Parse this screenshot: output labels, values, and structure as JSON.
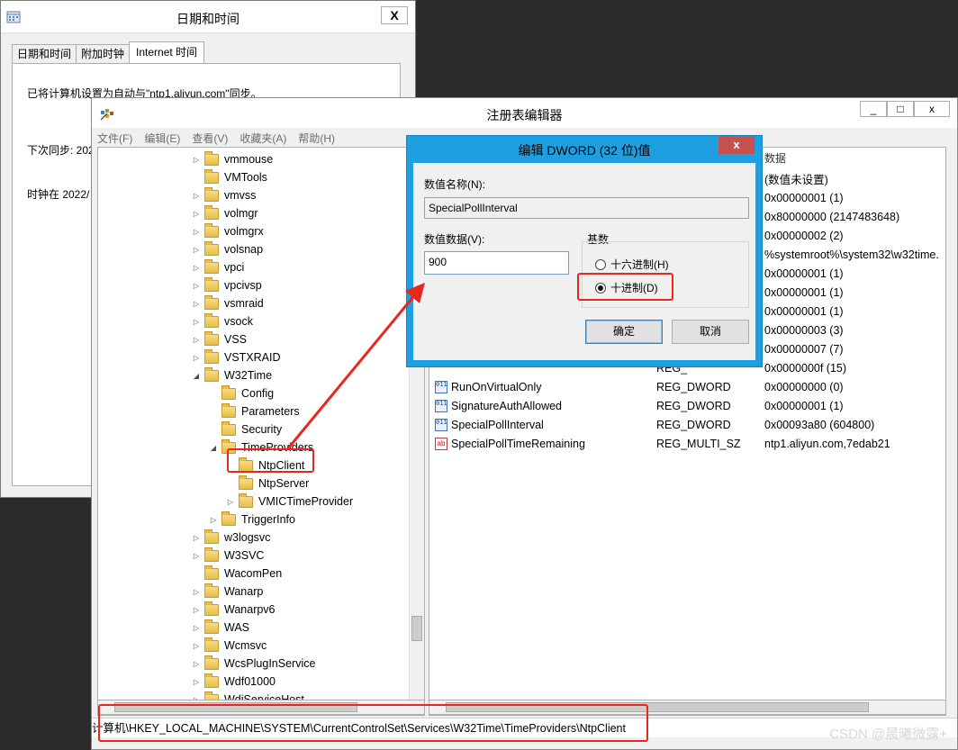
{
  "datetime_window": {
    "title": "日期和时间",
    "close_label": "X",
    "tabs": [
      "日期和时间",
      "附加时钟",
      "Internet 时间"
    ],
    "sync_text": "已将计算机设置为自动与\"ntp1.aliyun.com\"同步。",
    "next_sync": "下次同步: 202",
    "clock_text": "时钟在 2022/"
  },
  "regedit": {
    "title": "注册表编辑器",
    "window_buttons": [
      "_",
      "□",
      "x"
    ],
    "menu": [
      "文件(F)",
      "编辑(E)",
      "查看(V)",
      "收藏夹(A)",
      "帮助(H)"
    ],
    "tree": [
      {
        "label": "vmmouse",
        "depth": 0,
        "expand": "right"
      },
      {
        "label": "VMTools",
        "depth": 0,
        "expand": "none"
      },
      {
        "label": "vmvss",
        "depth": 0,
        "expand": "right"
      },
      {
        "label": "volmgr",
        "depth": 0,
        "expand": "right"
      },
      {
        "label": "volmgrx",
        "depth": 0,
        "expand": "right"
      },
      {
        "label": "volsnap",
        "depth": 0,
        "expand": "right"
      },
      {
        "label": "vpci",
        "depth": 0,
        "expand": "right"
      },
      {
        "label": "vpcivsp",
        "depth": 0,
        "expand": "right"
      },
      {
        "label": "vsmraid",
        "depth": 0,
        "expand": "right"
      },
      {
        "label": "vsock",
        "depth": 0,
        "expand": "right"
      },
      {
        "label": "VSS",
        "depth": 0,
        "expand": "right"
      },
      {
        "label": "VSTXRAID",
        "depth": 0,
        "expand": "right"
      },
      {
        "label": "W32Time",
        "depth": 0,
        "expand": "down"
      },
      {
        "label": "Config",
        "depth": 1,
        "expand": "none"
      },
      {
        "label": "Parameters",
        "depth": 1,
        "expand": "none"
      },
      {
        "label": "Security",
        "depth": 1,
        "expand": "none"
      },
      {
        "label": "TimeProviders",
        "depth": 1,
        "expand": "down"
      },
      {
        "label": "NtpClient",
        "depth": 2,
        "expand": "none"
      },
      {
        "label": "NtpServer",
        "depth": 2,
        "expand": "none"
      },
      {
        "label": "VMICTimeProvider",
        "depth": 2,
        "expand": "right"
      },
      {
        "label": "TriggerInfo",
        "depth": 1,
        "expand": "right"
      },
      {
        "label": "w3logsvc",
        "depth": 0,
        "expand": "right"
      },
      {
        "label": "W3SVC",
        "depth": 0,
        "expand": "right"
      },
      {
        "label": "WacomPen",
        "depth": 0,
        "expand": "none"
      },
      {
        "label": "Wanarp",
        "depth": 0,
        "expand": "right"
      },
      {
        "label": "Wanarpv6",
        "depth": 0,
        "expand": "right"
      },
      {
        "label": "WAS",
        "depth": 0,
        "expand": "right"
      },
      {
        "label": "Wcmsvc",
        "depth": 0,
        "expand": "right"
      },
      {
        "label": "WcsPlugInService",
        "depth": 0,
        "expand": "right"
      },
      {
        "label": "Wdf01000",
        "depth": 0,
        "expand": "right"
      },
      {
        "label": "WdiServiceHost",
        "depth": 0,
        "expand": "right"
      }
    ],
    "list_header_data": "数据",
    "values": [
      {
        "name": "",
        "type": "",
        "data": "(数值未设置)",
        "icon": "none"
      },
      {
        "name": "",
        "type": "",
        "data": "0x00000001 (1)",
        "icon": "none"
      },
      {
        "name": "",
        "type": "",
        "data": "0x80000000 (2147483648)",
        "icon": "none"
      },
      {
        "name": "",
        "type": "",
        "data": "0x00000002 (2)",
        "icon": "none"
      },
      {
        "name": "",
        "type": "",
        "data": "%systemroot%\\system32\\w32time.",
        "icon": "none"
      },
      {
        "name": "",
        "type": "",
        "data": "0x00000001 (1)",
        "icon": "none"
      },
      {
        "name": "",
        "type": "",
        "data": "0x00000001 (1)",
        "icon": "none"
      },
      {
        "name": "",
        "type": "",
        "data": "0x00000001 (1)",
        "icon": "none"
      },
      {
        "name": "",
        "type": "",
        "data": "0x00000003 (3)",
        "icon": "none"
      },
      {
        "name": "",
        "type": "",
        "data": "0x00000007 (7)",
        "icon": "none"
      },
      {
        "name": "",
        "type": "REG_",
        "data": "0x0000000f (15)",
        "icon": "none"
      },
      {
        "name": "RunOnVirtualOnly",
        "type": "REG_DWORD",
        "data": "0x00000000 (0)",
        "icon": "bin"
      },
      {
        "name": "SignatureAuthAllowed",
        "type": "REG_DWORD",
        "data": "0x00000001 (1)",
        "icon": "bin"
      },
      {
        "name": "SpecialPollInterval",
        "type": "REG_DWORD",
        "data": "0x00093a80 (604800)",
        "icon": "bin"
      },
      {
        "name": "SpecialPollTimeRemaining",
        "type": "REG_MULTI_SZ",
        "data": "ntp1.aliyun.com,7edab21",
        "icon": "ab"
      }
    ],
    "status_path": "计算机\\HKEY_LOCAL_MACHINE\\SYSTEM\\CurrentControlSet\\Services\\W32Time\\TimeProviders\\NtpClient"
  },
  "dialog": {
    "title": "编辑 DWORD (32 位)值",
    "close_label": "x",
    "name_label": "数值名称(N):",
    "name_value": "SpecialPollInterval",
    "data_label": "数值数据(V):",
    "data_value": "900",
    "base_label": "基数",
    "radio_hex": "十六进制(H)",
    "radio_dec": "十进制(D)",
    "selected_base": "dec",
    "ok_label": "确定",
    "cancel_label": "取消"
  },
  "watermark": "CSDN @晨曦微露+",
  "colors": {
    "highlight": "#e8281f",
    "dialog_frame": "#1e9fe0"
  }
}
